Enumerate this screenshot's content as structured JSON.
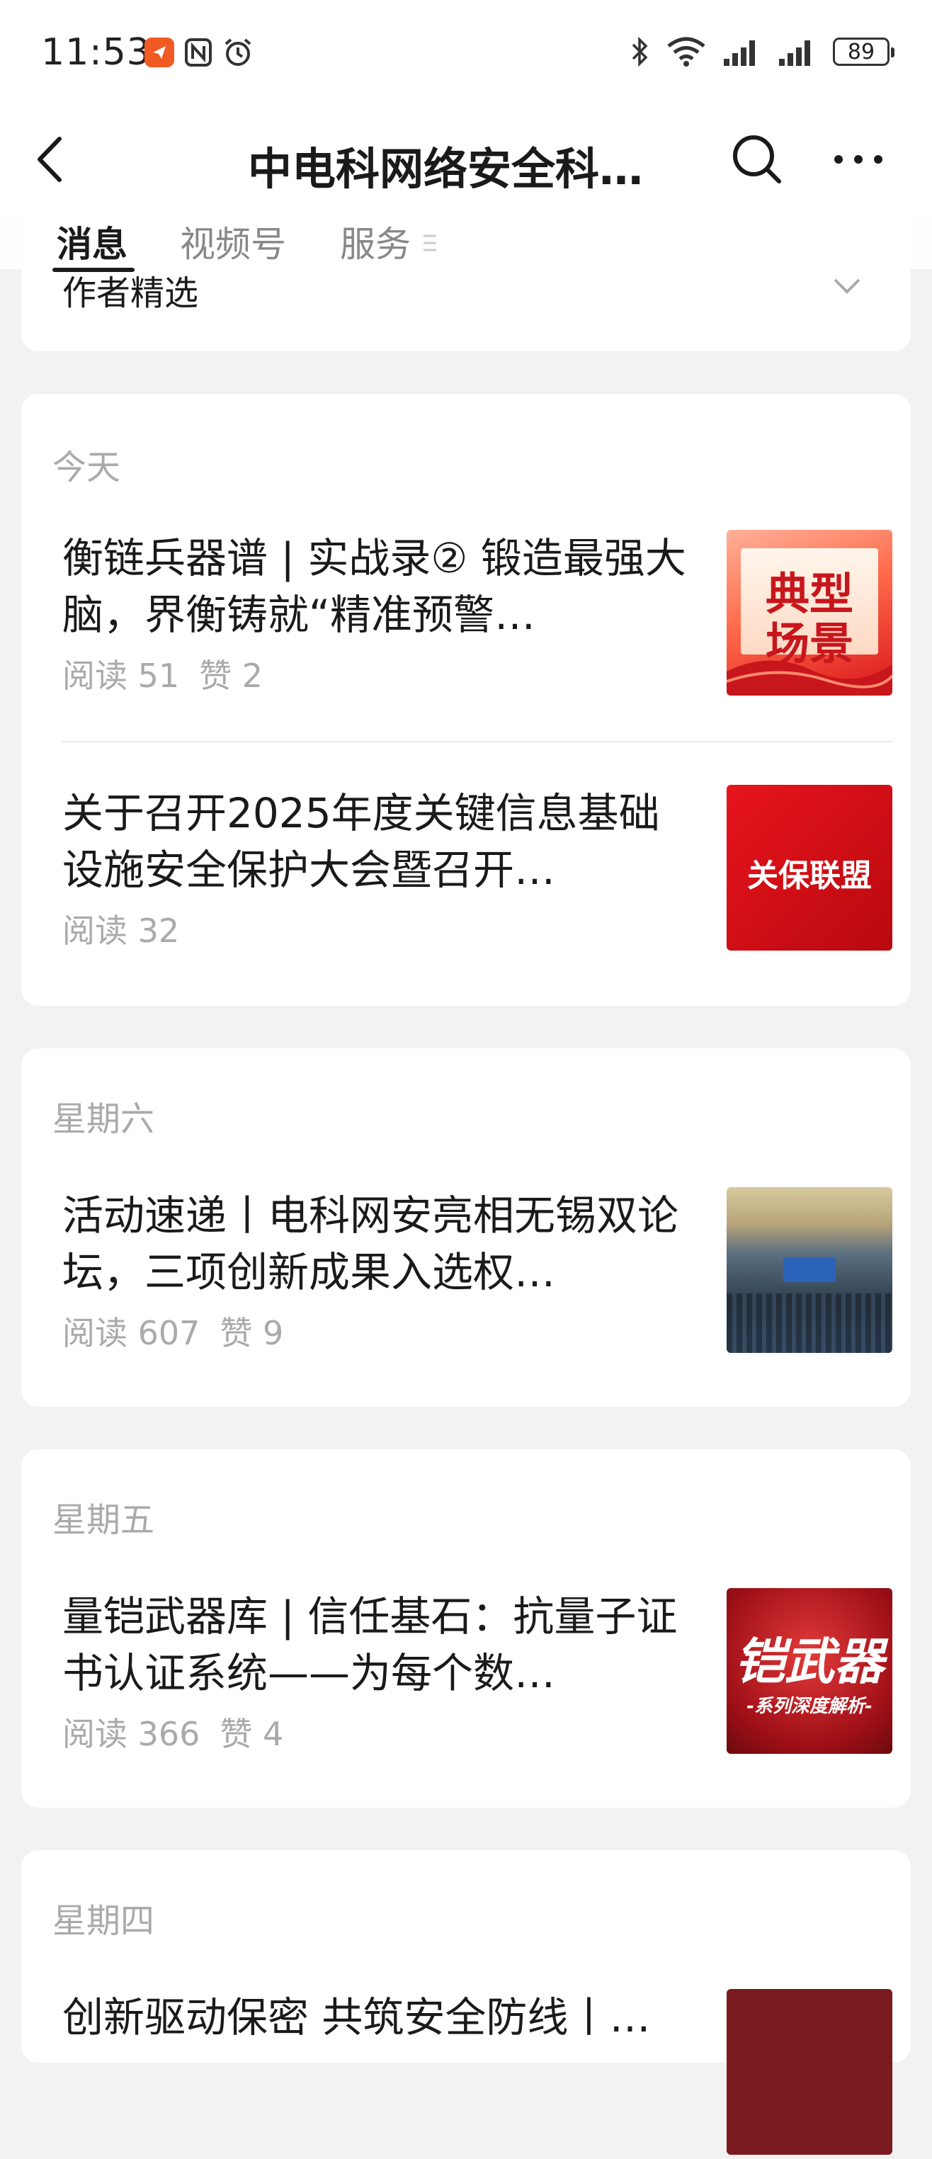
{
  "status": {
    "time": "11:53",
    "battery": "89"
  },
  "nav": {
    "title": "中电科网络安全科…"
  },
  "tabs": [
    {
      "label": "消息"
    },
    {
      "label": "视频号"
    },
    {
      "label": "服务"
    }
  ],
  "author_section": {
    "label": "作者精选"
  },
  "groups": [
    {
      "day": "今天",
      "articles": [
        {
          "title": "衡链兵器谱 | 实战录② 锻造最强大脑，界衡铸就“精准预警…",
          "reads": "阅读 51",
          "likes": "赞 2",
          "thumb_text": [
            "典型",
            "场景"
          ]
        },
        {
          "title": "关于召开2025年度关键信息基础设施安全保护大会暨召开…",
          "reads": "阅读 32",
          "likes": "",
          "thumb_text": [
            "关保联盟"
          ]
        }
      ]
    },
    {
      "day": "星期六",
      "articles": [
        {
          "title": "活动速递丨电科网安亮相无锡双论坛，三项创新成果入选权…",
          "reads": "阅读 607",
          "likes": "赞 9",
          "thumb_text": []
        }
      ]
    },
    {
      "day": "星期五",
      "articles": [
        {
          "title": "量铠武器库 | 信任基石：抗量子证书认证系统——为每个数…",
          "reads": "阅读 366",
          "likes": "赞 4",
          "thumb_text": [
            "铠武器",
            "-系列深度解析-"
          ]
        }
      ]
    },
    {
      "day": "星期四",
      "articles": [
        {
          "title": "创新驱动保密 共筑安全防线丨…",
          "reads": "",
          "likes": "",
          "thumb_text": []
        }
      ]
    }
  ]
}
